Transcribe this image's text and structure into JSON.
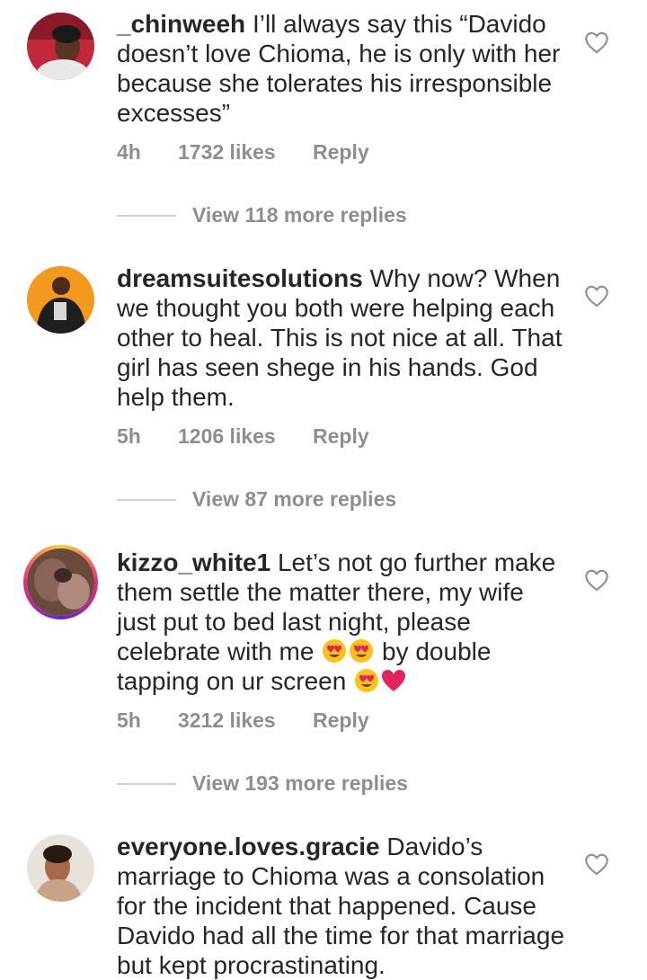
{
  "comments": [
    {
      "username": "_chinweeh",
      "text": " I’ll always say this “Davido doesn’t love Chioma, he is only with her because she tolerates his irresponsible excesses”",
      "time": "4h",
      "likes": "1732 likes",
      "reply": "Reply",
      "view_replies": "View 118 more replies",
      "avatar_icon": "profile-photo"
    },
    {
      "username": "dreamsuitesolutions",
      "text": " Why now? When we thought you both were helping each other to heal. This is not nice at all. That girl has seen shege in his hands. God help them.",
      "time": "5h",
      "likes": "1206 likes",
      "reply": "Reply",
      "view_replies": "View 87 more replies",
      "avatar_icon": "profile-photo"
    },
    {
      "username": "kizzo_white1",
      "text_part1": " Let’s not go further make them settle the matter there, my wife just put to bed last night, please celebrate with me ",
      "text_part2": " by double tapping on ur screen ",
      "time": "5h",
      "likes": "3212 likes",
      "reply": "Reply",
      "view_replies": "View 193 more replies",
      "avatar_icon": "profile-photo-with-story-ring",
      "emojis": [
        "heart-eyes-emoji",
        "heart-eyes-emoji",
        "heart-eyes-emoji",
        "red-heart-emoji"
      ]
    },
    {
      "username": "everyone.loves.gracie",
      "text": " Davido’s marriage to Chioma was a consolation for the incident that happened. Cause Davido had all the time for that marriage but kept procrastinating.",
      "avatar_icon": "profile-photo"
    }
  ],
  "colors": {
    "text": "#262626",
    "meta": "#8e8e8e",
    "divider": "#d0d0d0"
  }
}
